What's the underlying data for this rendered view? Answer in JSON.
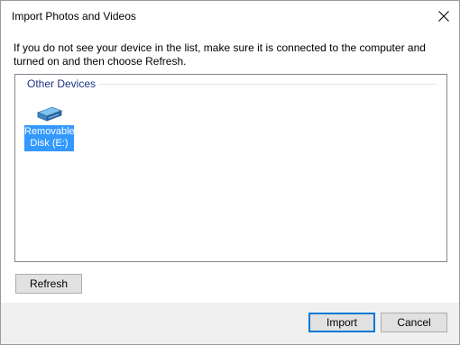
{
  "window": {
    "title": "Import Photos and Videos"
  },
  "message": "If you do not see your device in the list, make sure it is connected to the computer and turned on and then choose Refresh.",
  "device_list": {
    "group_header": "Other Devices",
    "devices": [
      {
        "label": "Removable Disk (E:)",
        "icon": "removable-disk-icon",
        "selected": true
      }
    ]
  },
  "buttons": {
    "refresh_label": "Refresh",
    "import_label": "Import",
    "cancel_label": "Cancel"
  },
  "colors": {
    "selection": "#3399ff",
    "group_header": "#1e3287",
    "default_button_border": "#0078d7"
  }
}
